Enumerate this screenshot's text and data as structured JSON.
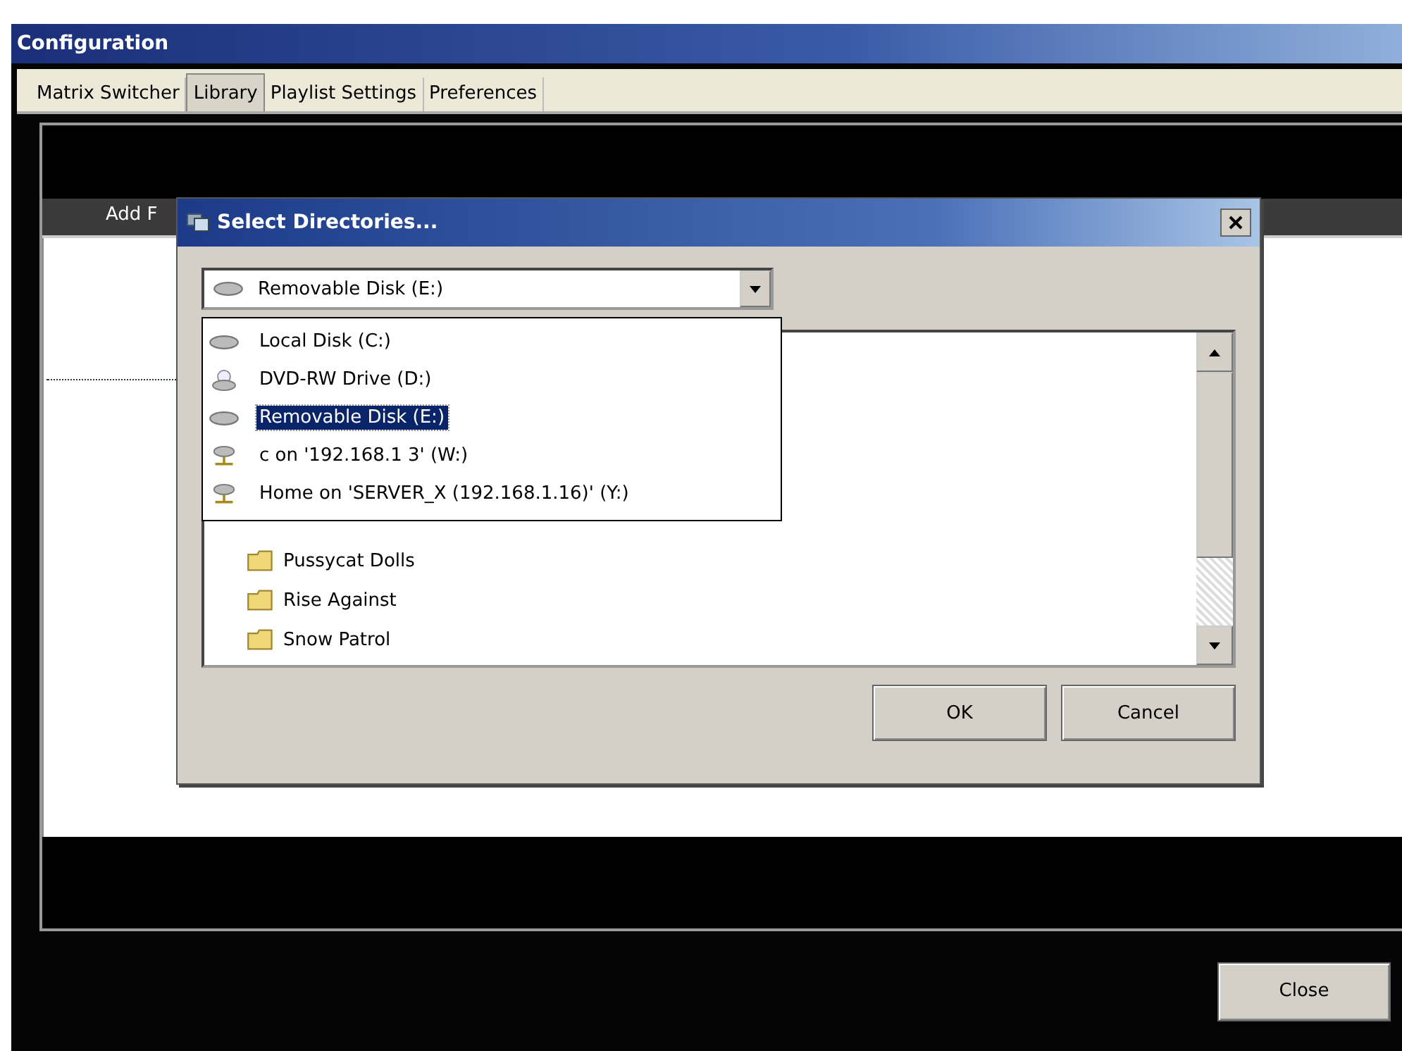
{
  "window": {
    "title": "Configuration"
  },
  "tabs": [
    {
      "label": "Matrix Switcher",
      "selected": false
    },
    {
      "label": "Library",
      "selected": true
    },
    {
      "label": "Playlist Settings",
      "selected": false
    },
    {
      "label": "Preferences",
      "selected": false
    }
  ],
  "library": {
    "add_button": "Add F"
  },
  "dialog": {
    "title": "Select Directories...",
    "drive_combo": {
      "value": "Removable Disk (E:)",
      "kind": "disk"
    },
    "drives": [
      {
        "label": "Local Disk (C:)",
        "kind": "disk",
        "selected": false
      },
      {
        "label": "DVD-RW Drive (D:)",
        "kind": "dvd",
        "selected": false
      },
      {
        "label": "Removable Disk (E:)",
        "kind": "disk",
        "selected": true
      },
      {
        "label": "c on '192.168.1 3' (W:)",
        "kind": "network",
        "selected": false
      },
      {
        "label": "Home on 'SERVER_X (192.168.1.16)' (Y:)",
        "kind": "network",
        "selected": false
      }
    ],
    "folders": [
      "Pussycat Dolls",
      "Rise Against",
      "Snow Patrol"
    ],
    "buttons": [
      "OK",
      "Cancel"
    ]
  },
  "close_button": "Close"
}
